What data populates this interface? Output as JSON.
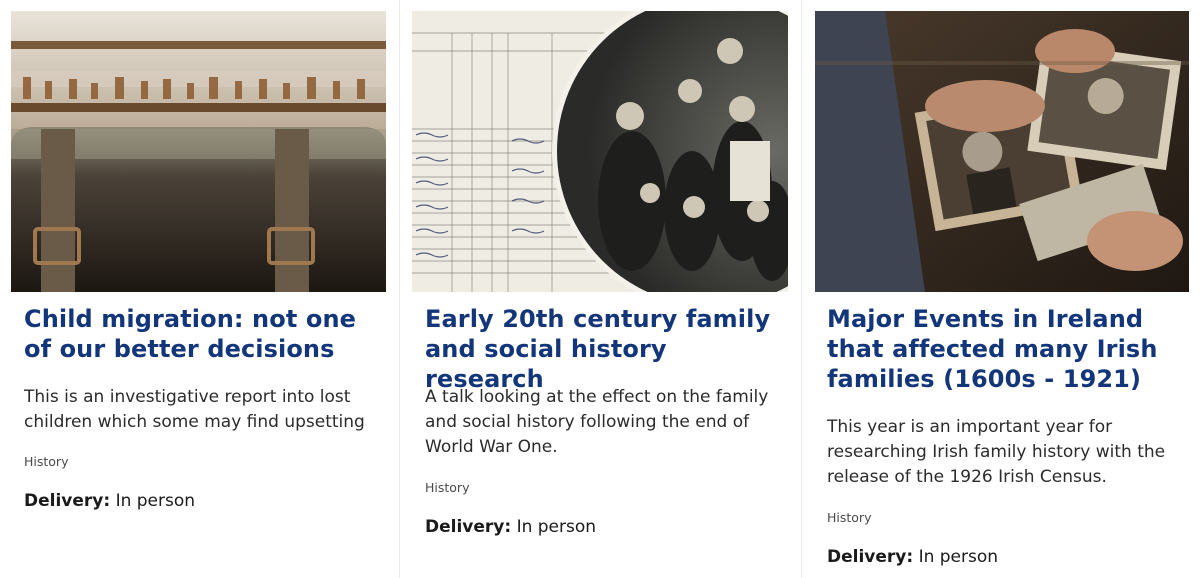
{
  "cards": [
    {
      "image_alt": "old leather suitcase in front of shelves of bottles",
      "title": "Child migration: not one of our better decisions",
      "description": "This is an investigative report into lost children which some may find upsetting",
      "category": "History",
      "delivery_label": "Delivery:",
      "delivery_value": "In person"
    },
    {
      "image_alt": "census form and a historic family photograph",
      "title": "Early 20th century family and social history research",
      "description": "A talk looking at the effect on the family and social history following the end of World War One.",
      "category": "History",
      "delivery_label": "Delivery:",
      "delivery_value": "In person"
    },
    {
      "image_alt": "hands sorting through old photographs",
      "title": "Major Events in Ireland that affected many Irish families (1600s - 1921)",
      "description": "This year is an important year for researching Irish family history with the release of the 1926 Irish Census.",
      "category": "History",
      "delivery_label": "Delivery:",
      "delivery_value": "In person"
    }
  ],
  "colors": {
    "title": "#13367a",
    "text": "#2b2b2b",
    "separator": "#e9ecef"
  }
}
